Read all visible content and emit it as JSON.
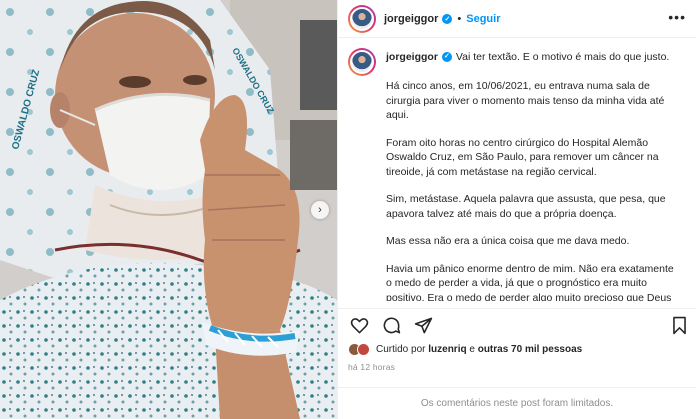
{
  "post": {
    "username": "jorgeiggor",
    "verified_icon": "verified-badge-icon",
    "separator": "•",
    "follow_label": "Seguir",
    "more_icon": "more-options-icon",
    "carousel_next": "›"
  },
  "caption": {
    "username": "jorgeiggor",
    "first_line": "Vai ter textão. E o motivo é mais do que justo.",
    "paragraphs": [
      "Há cinco anos, em 10/06/2021, eu entrava numa sala de cirurgia para viver o momento mais tenso da minha vida até aqui.",
      "Foram oito horas no centro cirúrgico do Hospital Alemão Oswaldo Cruz, em São Paulo, para remover um câncer na tireoide, já com metástase na região cervical.",
      "Sim, metástase. Aquela palavra que assusta, que pesa, que apavora talvez até mais do que a própria doença.",
      "Mas essa não era a única coisa que me dava medo.",
      "Havia um pânico enorme dentro de mim. Não era exatamente o medo de perder a vida, já que o prognóstico era muito positivo. Era o medo de perder algo muito precioso que Deus me deu: a voz para narrar futebol. A potência para gritar gol. O instrumento do meu trabalho. O ganha-pão que sustenta a minha família. O"
    ]
  },
  "actions": {
    "like_icon": "heart-icon",
    "comment_icon": "comment-icon",
    "share_icon": "share-icon",
    "save_icon": "bookmark-icon"
  },
  "likes": {
    "prefix": "Curtido por ",
    "user": "luzenriq",
    "middle": " e ",
    "others": "outras 70 mil pessoas"
  },
  "time": "há 12 horas",
  "comments_limited": "Os comentários neste post foram limitados.",
  "image": {
    "pillow_print_1": "OSWALDO CRUZ",
    "pillow_print_2": "OSWALDO CRUZ"
  },
  "colors": {
    "accent": "#0095f6",
    "text": "#262626",
    "muted": "#8e8e8e",
    "divider": "#efefef"
  }
}
